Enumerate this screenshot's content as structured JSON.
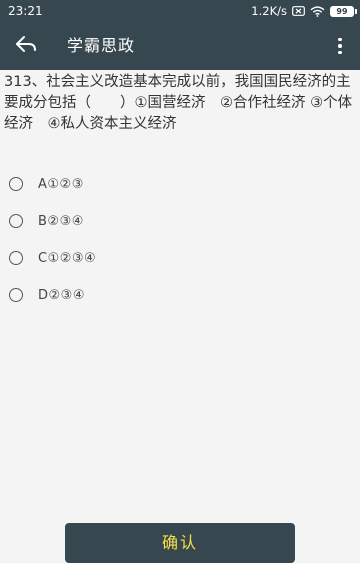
{
  "status_bar": {
    "time": "23:21",
    "network_speed": "1.2K/s",
    "battery_level": "99",
    "icons": [
      "sim-off-icon",
      "wifi-icon",
      "battery-icon"
    ]
  },
  "app_bar": {
    "title": "学霸思政",
    "back_icon": "back-arrow-icon",
    "menu_icon": "more-vert-icon"
  },
  "question": {
    "text": "313、社会主义改造基本完成以前，我国国民经济的主要成分包括（　　）①国营经济　②合作社经济 ③个体经济　④私人资本主义经济"
  },
  "options": [
    {
      "label": "A①②③",
      "selected": false
    },
    {
      "label": "B②③④",
      "selected": false
    },
    {
      "label": "C①②③④",
      "selected": false
    },
    {
      "label": "D②③④",
      "selected": false
    }
  ],
  "confirm_button": {
    "label": "确认"
  },
  "colors": {
    "primary": "#37474f",
    "background": "#f4f4f4",
    "confirm_text": "#f4e24a"
  }
}
